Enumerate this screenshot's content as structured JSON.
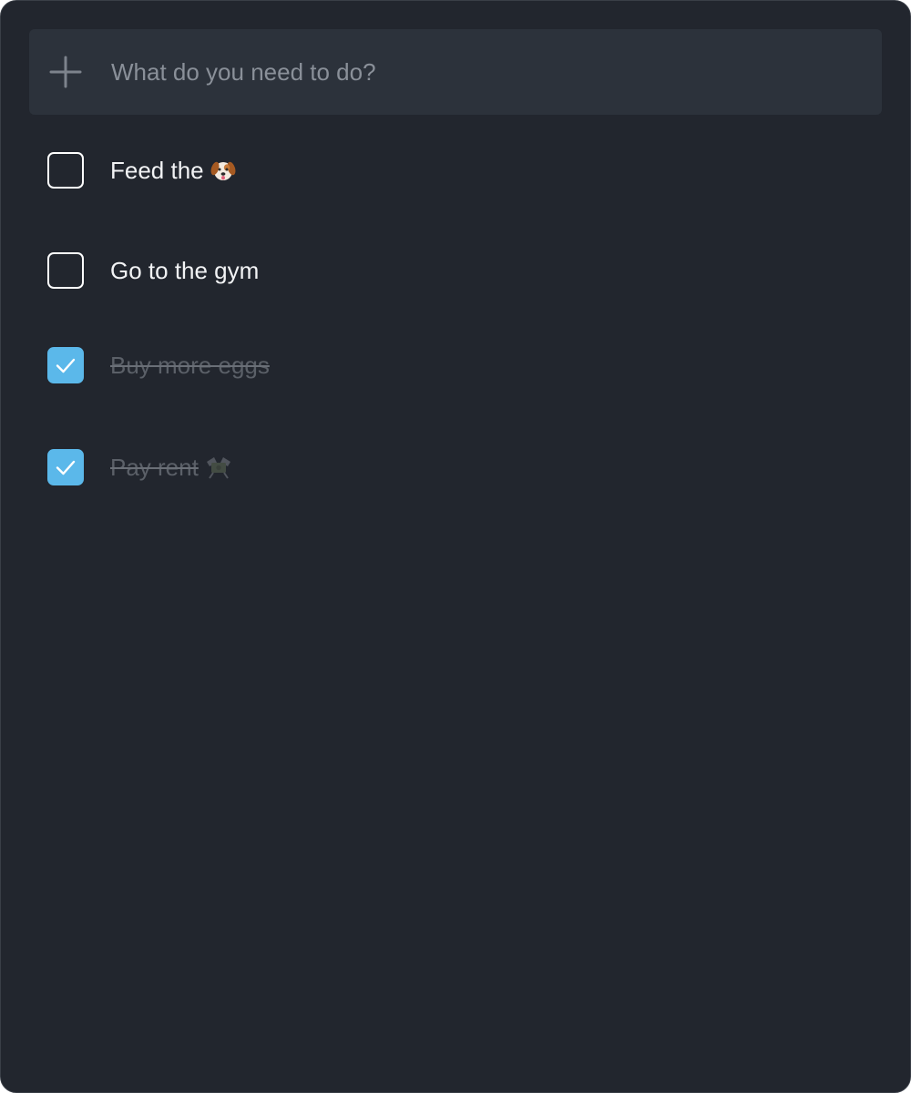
{
  "add_todo": {
    "placeholder": "What do you need to do?",
    "icon": "plus-icon"
  },
  "todos": [
    {
      "label": "Feed the",
      "icon": "dog-face-icon",
      "completed": false
    },
    {
      "label": "Go to the gym",
      "icon": "",
      "completed": false
    },
    {
      "label": "Buy more eggs",
      "icon": "",
      "completed": true
    },
    {
      "label": "Pay rent",
      "icon": "money-with-wings-icon",
      "completed": true
    }
  ],
  "colors": {
    "background": "#22262e",
    "input_background": "#2c323b",
    "accent": "#5bb8ea",
    "text": "#f2f3f5",
    "completed_text": "#5b6068"
  }
}
